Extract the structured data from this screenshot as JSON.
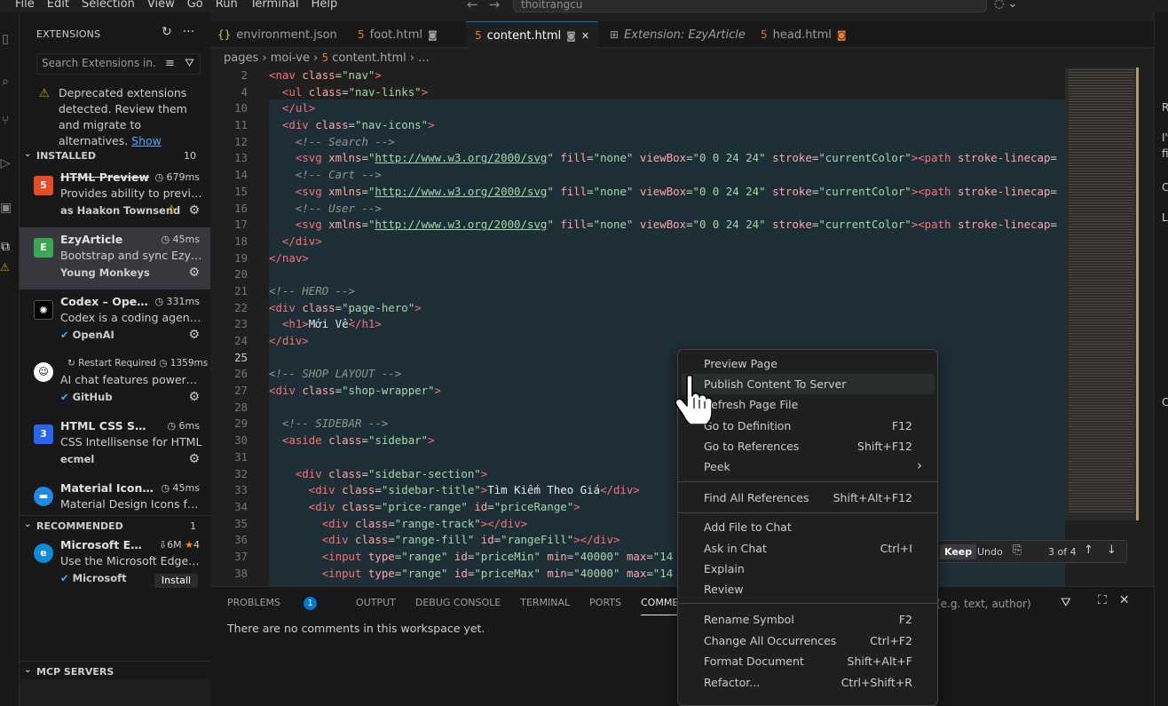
{
  "menu": [
    "File",
    "Edit",
    "Selection",
    "View",
    "Go",
    "Run",
    "Terminal",
    "Help"
  ],
  "command_center": "thoitrangcu",
  "sidebar": {
    "title": "EXTENSIONS",
    "search_placeholder": "Search Extensions in...",
    "deprecated_text": "Deprecated extensions detected. Review them and migrate to alternatives.",
    "deprecated_link": "Show",
    "installed_label": "INSTALLED",
    "installed_count": "10",
    "recommended_label": "RECOMMENDED",
    "recommended_count": "1",
    "mcp_label": "MCP SERVERS",
    "installed": [
      {
        "name": "HTML Preview",
        "time": "679ms",
        "desc": "Provides ability to preview...",
        "publisher": "Haakon Townsend",
        "icon_label": "5",
        "icon_color": "#e44d26"
      },
      {
        "name": "EzyArticle",
        "time": "45ms",
        "desc": "Bootstrap and sync EzyPla...",
        "publisher": "Young Monkeys",
        "icon_label": "E",
        "icon_color": "#3aa757"
      },
      {
        "name": "Codex – Open...",
        "time": "331ms",
        "desc": "Codex is a coding agent t...",
        "publisher": "OpenAI",
        "icon_label": "✺",
        "icon_color": "#ffffff"
      },
      {
        "name": "",
        "restart": "Restart Required",
        "time": "1359ms",
        "desc": "AI chat features powered ...",
        "publisher": "GitHub",
        "icon_label": "☺",
        "icon_color": "#ffffff"
      },
      {
        "name": "HTML CSS Supp...",
        "time": "6ms",
        "desc": "CSS Intellisense for HTML",
        "publisher": "ecmel",
        "icon_label": "3",
        "icon_color": "#2965f1"
      },
      {
        "name": "Material Icon T...",
        "time": "45ms",
        "desc": "Material Design Icons for ...",
        "publisher": "",
        "icon_label": "▬",
        "icon_color": "#1e88e5"
      }
    ],
    "recommended": [
      {
        "name": "Microsoft E...",
        "downloads": "6M",
        "rating": "4",
        "desc": "Use the Microsoft Edge To...",
        "publisher": "Microsoft",
        "install_label": "Install"
      }
    ]
  },
  "tabs": [
    {
      "label": "environment.json",
      "icon": "{}"
    },
    {
      "label": "foot.html",
      "icon": "5"
    },
    {
      "label": "content.html",
      "icon": "5"
    },
    {
      "label": "Extension: EzyArticle",
      "icon": "⊞"
    },
    {
      "label": "head.html",
      "icon": "5"
    }
  ],
  "breadcrumb": {
    "p1": "pages",
    "p2": "moi-ve",
    "p3": "content.html",
    "p4": "..."
  },
  "code_lines": [
    {
      "n": "2",
      "html": "<span class='t-tag'>&lt;nav</span> <span class='t-attr'>class</span>=<span class='t-str'>\"nav\"</span><span class='t-tag'>&gt;</span>"
    },
    {
      "n": "4",
      "html": "  <span class='t-tag'>&lt;ul</span> <span class='t-attr'>class</span>=<span class='t-str'>\"nav-links\"</span><span class='t-tag'>&gt;</span>"
    },
    {
      "n": "10",
      "html": "  <span class='t-tag'>&lt;/ul&gt;</span>"
    },
    {
      "n": "11",
      "html": "  <span class='t-tag'>&lt;div</span> <span class='t-attr'>class</span>=<span class='t-str'>\"nav-icons\"</span><span class='t-tag'>&gt;</span>"
    },
    {
      "n": "12",
      "html": "    <span class='t-com'>&lt;!-- Search --&gt;</span>"
    },
    {
      "n": "13",
      "html": "    <span class='t-tag'>&lt;svg</span> <span class='t-attr'>xmlns</span>=<span class='t-str'>\"</span><span class='t-url'>http://www.w3.org/2000/svg</span><span class='t-str'>\"</span> <span class='t-attr'>fill</span>=<span class='t-str'>\"none\"</span> <span class='t-attr'>viewBox</span>=<span class='t-str'>\"0 0 24 24\"</span> <span class='t-attr'>stroke</span>=<span class='t-str'>\"currentColor\"</span><span class='t-tag'>&gt;&lt;path</span> <span class='t-attr'>stroke-linecap</span>="
    },
    {
      "n": "14",
      "html": "    <span class='t-com'>&lt;!-- Cart --&gt;</span>"
    },
    {
      "n": "15",
      "html": "    <span class='t-tag'>&lt;svg</span> <span class='t-attr'>xmlns</span>=<span class='t-str'>\"</span><span class='t-url'>http://www.w3.org/2000/svg</span><span class='t-str'>\"</span> <span class='t-attr'>fill</span>=<span class='t-str'>\"none\"</span> <span class='t-attr'>viewBox</span>=<span class='t-str'>\"0 0 24 24\"</span> <span class='t-attr'>stroke</span>=<span class='t-str'>\"currentColor\"</span><span class='t-tag'>&gt;&lt;path</span> <span class='t-attr'>stroke-linecap</span>="
    },
    {
      "n": "16",
      "html": "    <span class='t-com'>&lt;!-- User --&gt;</span>"
    },
    {
      "n": "17",
      "html": "    <span class='t-tag'>&lt;svg</span> <span class='t-attr'>xmlns</span>=<span class='t-str'>\"</span><span class='t-url'>http://www.w3.org/2000/svg</span><span class='t-str'>\"</span> <span class='t-attr'>fill</span>=<span class='t-str'>\"none\"</span> <span class='t-attr'>viewBox</span>=<span class='t-str'>\"0 0 24 24\"</span> <span class='t-attr'>stroke</span>=<span class='t-str'>\"currentColor\"</span><span class='t-tag'>&gt;&lt;path</span> <span class='t-attr'>stroke-linecap</span>="
    },
    {
      "n": "18",
      "html": "  <span class='t-tag'>&lt;/div&gt;</span>"
    },
    {
      "n": "19",
      "html": "<span class='t-tag'>&lt;/nav&gt;</span>"
    },
    {
      "n": "20",
      "html": ""
    },
    {
      "n": "21",
      "html": "<span class='t-com'>&lt;!-- HERO --&gt;</span>"
    },
    {
      "n": "22",
      "html": "<span class='t-tag'>&lt;div</span> <span class='t-attr'>class</span>=<span class='t-str'>\"page-hero\"</span><span class='t-tag'>&gt;</span>"
    },
    {
      "n": "23",
      "html": "  <span class='t-tag'>&lt;h1&gt;</span><span class='t-txt'>Mới Về</span><span class='t-tag'>&lt;/h1&gt;</span>"
    },
    {
      "n": "24",
      "html": "<span class='t-tag'>&lt;/div&gt;</span>"
    },
    {
      "n": "25",
      "html": "",
      "cur": true
    },
    {
      "n": "26",
      "html": "<span class='t-com'>&lt;!-- SHOP LAYOUT --&gt;</span>"
    },
    {
      "n": "27",
      "html": "<span class='t-tag'>&lt;div</span> <span class='t-attr'>class</span>=<span class='t-str'>\"shop-wrapper\"</span><span class='t-tag'>&gt;</span>"
    },
    {
      "n": "28",
      "html": ""
    },
    {
      "n": "29",
      "html": "  <span class='t-com'>&lt;!-- SIDEBAR --&gt;</span>"
    },
    {
      "n": "30",
      "html": "  <span class='t-tag'>&lt;aside</span> <span class='t-attr'>class</span>=<span class='t-str'>\"sidebar\"</span><span class='t-tag'>&gt;</span>"
    },
    {
      "n": "31",
      "html": ""
    },
    {
      "n": "32",
      "html": "    <span class='t-tag'>&lt;div</span> <span class='t-attr'>class</span>=<span class='t-str'>\"sidebar-section\"</span><span class='t-tag'>&gt;</span>"
    },
    {
      "n": "33",
      "html": "      <span class='t-tag'>&lt;div</span> <span class='t-attr'>class</span>=<span class='t-str'>\"sidebar-title\"</span><span class='t-tag'>&gt;</span><span class='t-txt'>Tìm Kiếm Theo Giá</span><span class='t-tag'>&lt;/div&gt;</span>"
    },
    {
      "n": "34",
      "html": "      <span class='t-tag'>&lt;div</span> <span class='t-attr'>class</span>=<span class='t-str'>\"price-range\"</span> <span class='t-attr'>id</span>=<span class='t-str'>\"priceRange\"</span><span class='t-tag'>&gt;</span>"
    },
    {
      "n": "35",
      "html": "        <span class='t-tag'>&lt;div</span> <span class='t-attr'>class</span>=<span class='t-str'>\"range-track\"</span><span class='t-tag'>&gt;&lt;/div&gt;</span>"
    },
    {
      "n": "36",
      "html": "        <span class='t-tag'>&lt;div</span> <span class='t-attr'>class</span>=<span class='t-str'>\"range-fill\"</span> <span class='t-attr'>id</span>=<span class='t-str'>\"rangeFill\"</span><span class='t-tag'>&gt;&lt;/div&gt;</span>"
    },
    {
      "n": "37",
      "html": "        <span class='t-tag'>&lt;input</span> <span class='t-attr'>type</span>=<span class='t-str'>\"range\"</span> <span class='t-attr'>id</span>=<span class='t-str'>\"priceMin\"</span> <span class='t-attr'>min</span>=<span class='t-str'>\"40000\"</span> <span class='t-attr'>max</span>=<span class='t-str'>\"14</span>"
    },
    {
      "n": "38",
      "html": "        <span class='t-tag'>&lt;input</span> <span class='t-attr'>type</span>=<span class='t-str'>\"range\"</span> <span class='t-attr'>id</span>=<span class='t-str'>\"priceMax\"</span> <span class='t-attr'>min</span>=<span class='t-str'>\"40000\"</span> <span class='t-attr'>max</span>=<span class='t-str'>\"14</span>"
    }
  ],
  "review_bar": {
    "keep": "Keep",
    "undo": "Undo",
    "count": "3 of 4"
  },
  "panel": {
    "tabs": [
      "PROBLEMS",
      "OUTPUT",
      "DEBUG CONSOLE",
      "TERMINAL",
      "PORTS",
      "COMMENTS"
    ],
    "problems_count": "1",
    "message": "There are no comments in this workspace yet.",
    "filter_placeholder": "(e.g. text, author)"
  },
  "context_menu": {
    "items": [
      {
        "label": "Preview Page",
        "key": ""
      },
      {
        "label": "Publish Content To Server",
        "key": ""
      },
      {
        "label": "Refresh Page File",
        "key": ""
      },
      {
        "label": "Go to Definition",
        "key": "F12"
      },
      {
        "label": "Go to References",
        "key": "Shift+F12"
      },
      {
        "label": "Peek",
        "key": "›"
      },
      {
        "label": "Find All References",
        "key": "Shift+Alt+F12"
      },
      {
        "label": "Add File to Chat",
        "key": ""
      },
      {
        "label": "Ask in Chat",
        "key": "Ctrl+I"
      },
      {
        "label": "Explain",
        "key": ""
      },
      {
        "label": "Review",
        "key": ""
      },
      {
        "label": "Rename Symbol",
        "key": "F2"
      },
      {
        "label": "Change All Occurrences",
        "key": "Ctrl+F2"
      },
      {
        "label": "Format Document",
        "key": "Shift+Alt+F"
      },
      {
        "label": "Refactor...",
        "key": "Ctrl+Shift+R"
      }
    ]
  },
  "right_strip": [
    "R",
    "I'",
    "fi",
    "C",
    "L",
    "C"
  ],
  "colors": {
    "accent": "#0078d4",
    "warning": "#cca700",
    "html_icon": "#e37933"
  }
}
